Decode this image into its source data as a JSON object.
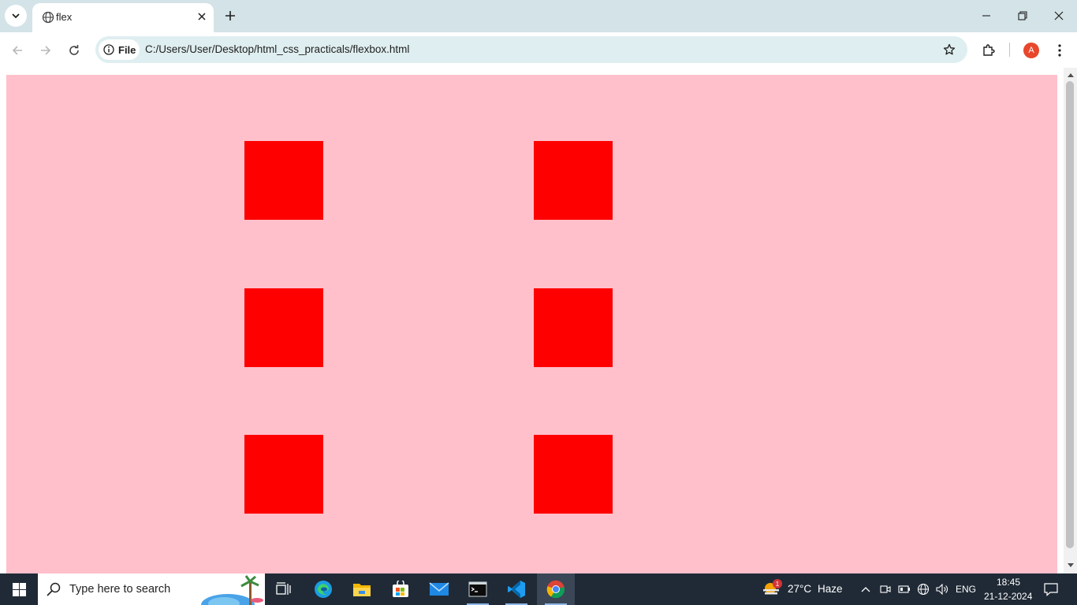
{
  "browser": {
    "tab": {
      "title": "flex",
      "close_icon": "close-icon"
    },
    "omnibox": {
      "site_chip_label": "File",
      "url": "C:/Users/User/Desktop/html_css_practicals/flexbox.html"
    },
    "profile_initial": "A"
  },
  "page": {
    "background": "#ffc0cb",
    "box_color": "#ff0000",
    "box_count": 6
  },
  "taskbar": {
    "search_placeholder": "Type here to search",
    "weather": {
      "temp": "27°C",
      "condition": "Haze",
      "badge": "1"
    },
    "language": "ENG",
    "time": "18:45",
    "date": "21-12-2024"
  },
  "colors": {
    "tabbar": "#d3e3e8",
    "omnibox": "#dfeef0",
    "taskbar": "#202a36",
    "accent_chrome_profile": "#e8472b"
  }
}
